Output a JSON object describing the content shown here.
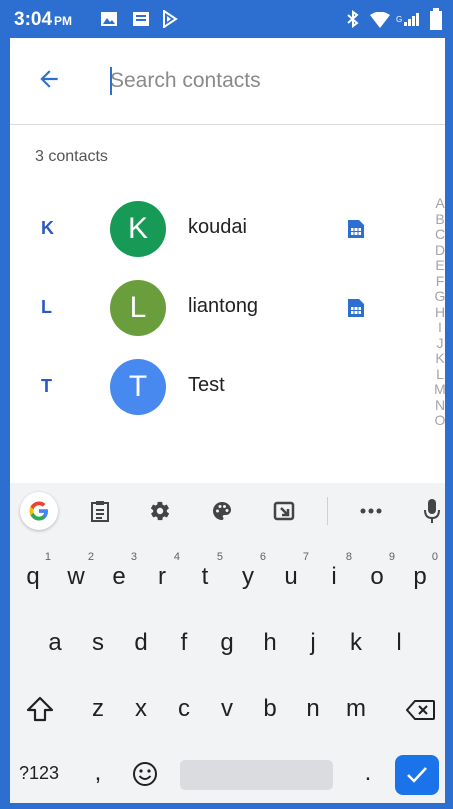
{
  "status_bar": {
    "time": "3:04",
    "ampm": "PM",
    "bg_color": "#2d6fd0",
    "left_icons": [
      "image-icon",
      "message-icon",
      "play-store-icon"
    ],
    "right_icons": [
      "bluetooth-icon",
      "wifi-icon",
      "signal-icon",
      "battery-icon"
    ]
  },
  "search": {
    "placeholder": "Search contacts",
    "value": "",
    "back_icon": "back-arrow-icon"
  },
  "contacts_count": "3 contacts",
  "contacts": [
    {
      "section": "K",
      "initial": "K",
      "name": "koudai",
      "avatar_color": "#179a56",
      "sim_icon": true
    },
    {
      "section": "L",
      "initial": "L",
      "name": "liantong",
      "avatar_color": "#6a9e3c",
      "sim_icon": true
    },
    {
      "section": "T",
      "initial": "T",
      "name": "Test",
      "avatar_color": "#4889ef",
      "sim_icon": false
    }
  ],
  "alphabet": [
    "A",
    "B",
    "C",
    "D",
    "E",
    "F",
    "G",
    "H",
    "I",
    "J",
    "K",
    "L",
    "M",
    "N",
    "O"
  ],
  "keyboard": {
    "toolbar_icons": [
      "google-icon",
      "clipboard-icon",
      "settings-icon",
      "palette-icon",
      "resize-icon",
      "more-icon",
      "mic-icon"
    ],
    "row1": [
      {
        "k": "q",
        "n": "1"
      },
      {
        "k": "w",
        "n": "2"
      },
      {
        "k": "e",
        "n": "3"
      },
      {
        "k": "r",
        "n": "4"
      },
      {
        "k": "t",
        "n": "5"
      },
      {
        "k": "y",
        "n": "6"
      },
      {
        "k": "u",
        "n": "7"
      },
      {
        "k": "i",
        "n": "8"
      },
      {
        "k": "o",
        "n": "9"
      },
      {
        "k": "p",
        "n": "0"
      }
    ],
    "row2": [
      "a",
      "s",
      "d",
      "f",
      "g",
      "h",
      "j",
      "k",
      "l"
    ],
    "row3": [
      "z",
      "x",
      "c",
      "v",
      "b",
      "n",
      "m"
    ],
    "symbols_label": "?123",
    "comma": ",",
    "period": ".",
    "accent_color": "#1a73e8"
  }
}
